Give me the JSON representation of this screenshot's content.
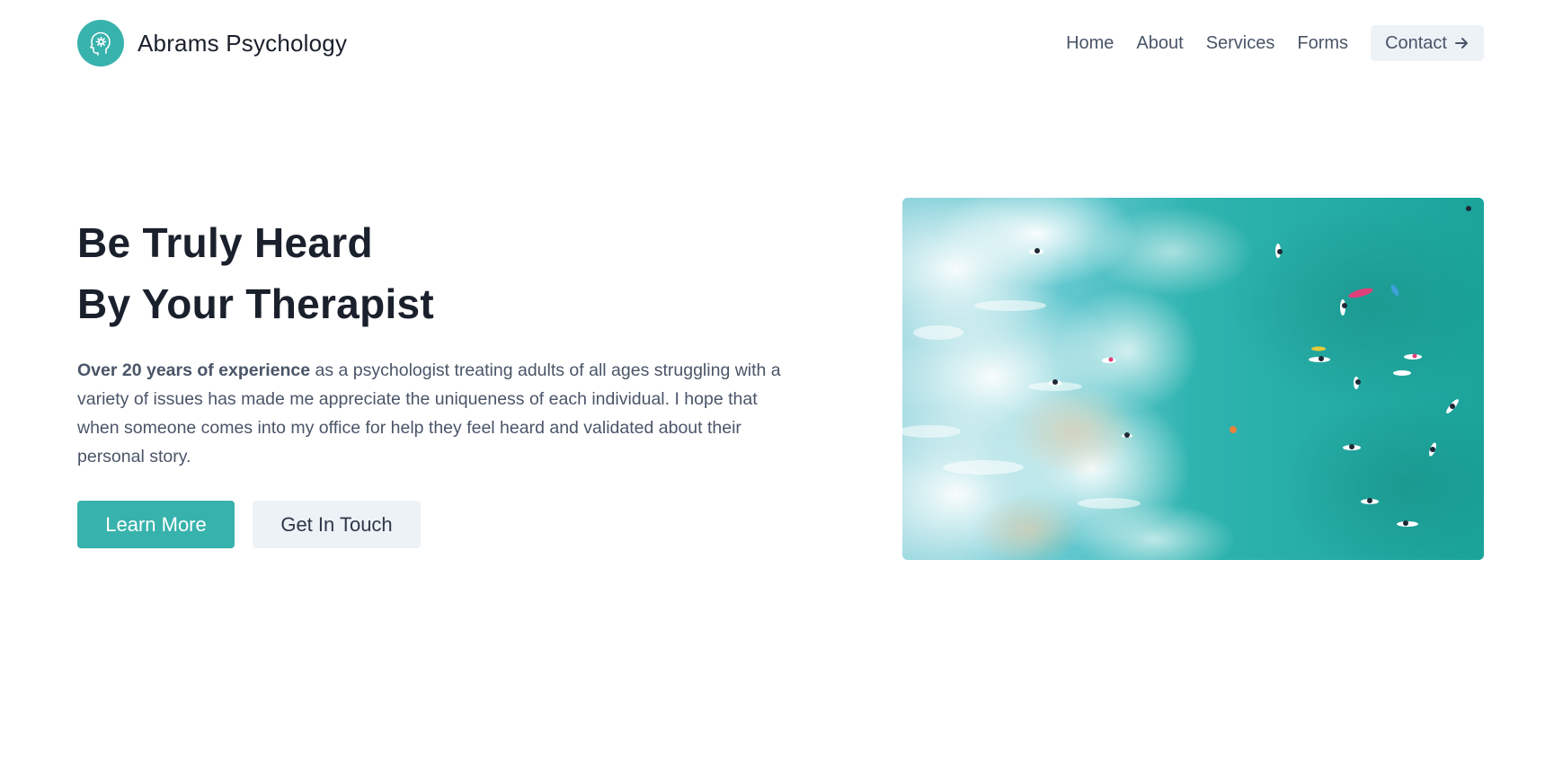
{
  "brand": {
    "name": "Abrams Psychology",
    "logo_icon": "brain-head-icon"
  },
  "nav": {
    "items": [
      "Home",
      "About",
      "Services",
      "Forms"
    ],
    "contact_label": "Contact",
    "contact_icon": "arrow-right-icon"
  },
  "hero": {
    "title_line1": "Be Truly Heard",
    "title_line2": "By Your Therapist",
    "desc_bold": "Over 20 years of experience",
    "desc_rest": " as a psychologist treating adults of all ages struggling with a variety of issues has made me appreciate the uniqueness of each individual. I hope that when someone comes into my office for help they feel heard and validated about their personal story.",
    "primary_button": "Learn More",
    "secondary_button": "Get In Touch"
  },
  "colors": {
    "accent": "#38b2ac",
    "text_dark": "#1a202c",
    "text_muted": "#4a5568",
    "button_light": "#edf2f7"
  }
}
